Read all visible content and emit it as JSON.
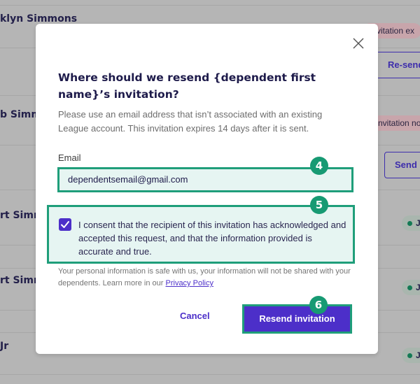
{
  "background_table": {
    "rows": [
      {
        "name": "klyn Simmons",
        "status": "Invitation ex",
        "status_type": "expired",
        "faint_text": "..."
      },
      {
        "action_button": "Re-send"
      },
      {
        "name": "b Simmons",
        "status": "nvitation no",
        "status_type": "not-sent"
      },
      {
        "action_button": "Send"
      },
      {
        "name": "rt Simm",
        "status": "Jo",
        "status_type": "joined"
      },
      {
        "name": "rt Simm",
        "status": "Jo",
        "status_type": "joined"
      },
      {
        "name": "Jr",
        "status": "Jo",
        "status_type": "joined"
      }
    ]
  },
  "modal": {
    "title": "Where should we resend {dependent first name}’s invitation?",
    "description": "Please use an email address that isn’t associated with an existing League account. This invitation expires 14 days after it is sent.",
    "email_label": "Email",
    "email_value": "dependentsemail@gmail.com",
    "consent_checked": true,
    "consent_text": "I consent that the recipient of this invitation has acknowledged and accepted this request, and that the information provided is accurate and true.",
    "privacy_note": "Your personal information is safe with us, your information will not be shared with your dependents. Learn more in our",
    "privacy_link": "Privacy Policy",
    "cancel_label": "Cancel",
    "resend_label": "Resend invitation",
    "close_icon": "close-icon"
  },
  "annotations": {
    "step_email": "4",
    "step_consent": "5",
    "step_resend": "6"
  },
  "colors": {
    "primary": "#4c2fc9",
    "highlight": "#1f9e7a",
    "highlight_fill": "#e6f5f2",
    "title": "#1d1a4a"
  }
}
